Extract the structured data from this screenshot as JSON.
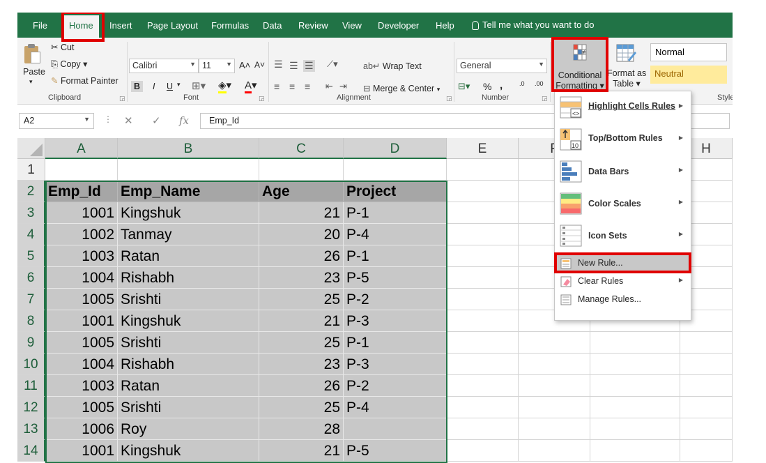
{
  "tabs": [
    "File",
    "Home",
    "Insert",
    "Page Layout",
    "Formulas",
    "Data",
    "Review",
    "View",
    "Developer",
    "Help"
  ],
  "tell_me": "Tell me what you want to do",
  "ribbon": {
    "clipboard": {
      "paste": "Paste",
      "cut": "Cut",
      "copy": "Copy",
      "format_painter": "Format Painter",
      "label": "Clipboard"
    },
    "font": {
      "name": "Calibri",
      "size": "11",
      "grow": "A",
      "shrink": "A",
      "bold": "B",
      "italic": "I",
      "underline": "U",
      "label": "Font"
    },
    "alignment": {
      "wrap_text": "Wrap Text",
      "merge_center": "Merge & Center",
      "label": "Alignment"
    },
    "number": {
      "format": "General",
      "percent": "%",
      "comma": ",",
      "inc_dec": ".0",
      "dec_dec": ".00",
      "label": "Number"
    },
    "styles": {
      "cf_line1": "Conditional",
      "cf_line2": "Formatting",
      "fat_line1": "Format as",
      "fat_line2": "Table",
      "normal": "Normal",
      "neutral": "Neutral",
      "label": "Style"
    }
  },
  "formula_bar": {
    "name_box": "A2",
    "fx": "fx",
    "value": "Emp_Id"
  },
  "columns": [
    "A",
    "B",
    "C",
    "D",
    "E",
    "F",
    "G",
    "H"
  ],
  "rows": [
    "1",
    "2",
    "3",
    "4",
    "5",
    "6",
    "7",
    "8",
    "9",
    "10",
    "11",
    "12",
    "13",
    "14"
  ],
  "table": {
    "headers": [
      "Emp_Id",
      "Emp_Name",
      "Age",
      "Project"
    ],
    "data": [
      [
        "1001",
        "Kingshuk",
        "21",
        "P-1"
      ],
      [
        "1002",
        "Tanmay",
        "20",
        "P-4"
      ],
      [
        "1003",
        "Ratan",
        "26",
        "P-1"
      ],
      [
        "1004",
        "Rishabh",
        "23",
        "P-5"
      ],
      [
        "1005",
        "Srishti",
        "25",
        "P-2"
      ],
      [
        "1001",
        "Kingshuk",
        "21",
        "P-3"
      ],
      [
        "1005",
        "Srishti",
        "25",
        "P-1"
      ],
      [
        "1004",
        "Rishabh",
        "23",
        "P-3"
      ],
      [
        "1003",
        "Ratan",
        "26",
        "P-2"
      ],
      [
        "1005",
        "Srishti",
        "25",
        "P-4"
      ],
      [
        "1006",
        "Roy",
        "28",
        ""
      ],
      [
        "1001",
        "Kingshuk",
        "21",
        "P-5"
      ]
    ]
  },
  "menu": {
    "highlight": "Highlight Cells Rules",
    "topbottom": "Top/Bottom Rules",
    "databars": "Data Bars",
    "colorscales": "Color Scales",
    "iconsets": "Icon Sets",
    "newrule": "New Rule...",
    "clearrules": "Clear Rules",
    "managerules": "Manage Rules..."
  },
  "colors": {
    "excel_green": "#217346",
    "highlight_red": "#e00000",
    "selection_gray": "#c8c8c8",
    "header_gray": "#a6a6a6",
    "neutral_bg": "#ffeb9c",
    "neutral_text": "#9c6500"
  }
}
